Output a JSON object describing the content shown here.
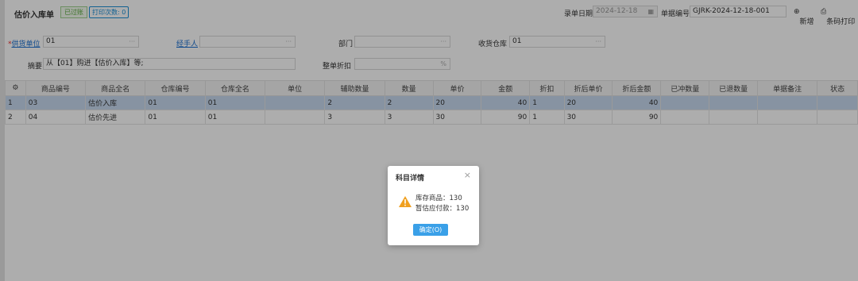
{
  "header": {
    "title": "估价入库单",
    "audit_badge": "已过账",
    "print_badge": "打印次数: 0",
    "date_label": "录单日期",
    "date_value": "2024-12-18",
    "number_label": "单据编号",
    "number_value": "GJRK-2024-12-18-001",
    "new_label": "新增",
    "barcode_label": "条码打印"
  },
  "form": {
    "supplier_label": "供货单位",
    "supplier_value": "01",
    "handler_label": "经手人",
    "dept_label": "部门",
    "warehouse_label": "收货仓库",
    "warehouse_value": "01",
    "summary_label": "摘要",
    "summary_value": "从【01】购进【估价入库】等;",
    "discount_label": "整单折扣",
    "discount_unit": "%",
    "dots": "···"
  },
  "table": {
    "headers": [
      "商品编号",
      "商品全名",
      "仓库编号",
      "仓库全名",
      "单位",
      "辅助数量",
      "数量",
      "单价",
      "金额",
      "折扣",
      "折后单价",
      "折后金额",
      "已冲数量",
      "已退数量",
      "单据备注",
      "状态"
    ],
    "rows": [
      [
        "1",
        "03",
        "估价入库",
        "01",
        "01",
        "",
        "2",
        "2",
        "20",
        "40",
        "1",
        "20",
        "40",
        "",
        "",
        "",
        ""
      ],
      [
        "2",
        "04",
        "估价先进",
        "01",
        "01",
        "",
        "3",
        "3",
        "30",
        "90",
        "1",
        "30",
        "90",
        "",
        "",
        "",
        ""
      ]
    ]
  },
  "dialog": {
    "title": "科目详情",
    "line1": "库存商品：130",
    "line2": "暂估应付款：130",
    "ok_label": "确定(O)"
  },
  "colors": {
    "accent": "#1a8fd8",
    "selected_row": "#c7d9ef",
    "ok_button": "#3aa0e8",
    "warning": "#f0a020"
  }
}
